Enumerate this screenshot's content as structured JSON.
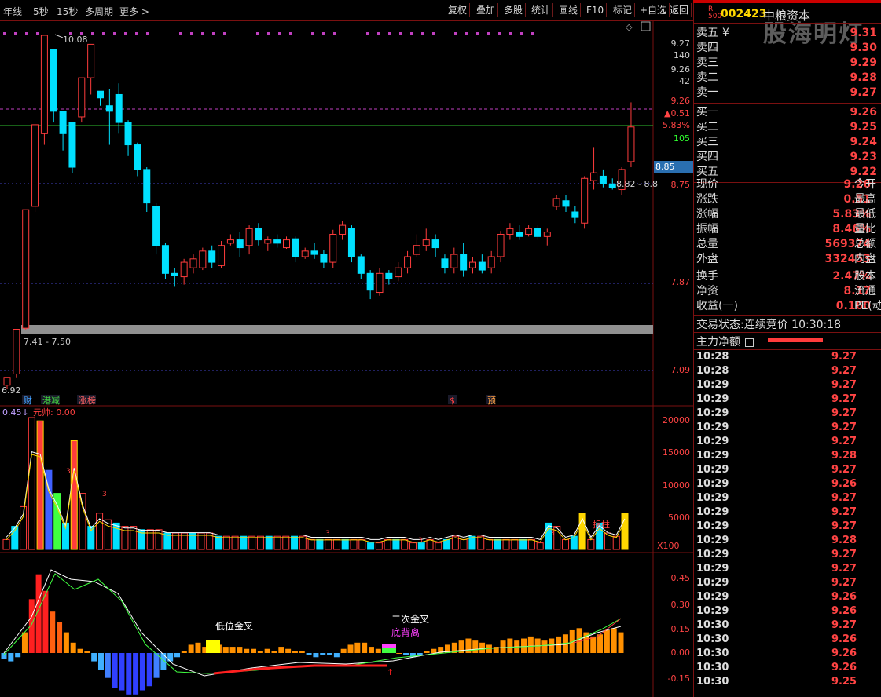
{
  "toolbar": {
    "left_items": [
      "年线",
      "5秒",
      "15秒",
      "多周期",
      "更多 >"
    ],
    "buttons": [
      "复权",
      "叠加",
      "多股",
      "统计",
      "画线",
      "F10",
      "标记",
      "+自选",
      "返回"
    ]
  },
  "watermark": "股海明灯",
  "stock": {
    "badge_top": "R",
    "badge_bottom": "500",
    "code": "002423",
    "name": "中粮资本"
  },
  "order_book": {
    "asks": [
      {
        "label": "卖五",
        "price": "9.31",
        "mark": "¥"
      },
      {
        "label": "卖四",
        "price": "9.30"
      },
      {
        "label": "卖三",
        "price": "9.29"
      },
      {
        "label": "卖二",
        "price": "9.28"
      },
      {
        "label": "卖一",
        "price": "9.27"
      }
    ],
    "bids": [
      {
        "label": "买一",
        "price": "9.26"
      },
      {
        "label": "买二",
        "price": "9.25"
      },
      {
        "label": "买三",
        "price": "9.24"
      },
      {
        "label": "买四",
        "price": "9.23"
      },
      {
        "label": "买五",
        "price": "9.22"
      }
    ]
  },
  "quote": [
    {
      "label": "现价",
      "value": "9.26",
      "label2": "今开"
    },
    {
      "label": "涨跌",
      "value": "0.51",
      "label2": "最高"
    },
    {
      "label": "涨幅",
      "value": "5.83%",
      "label2": "最低"
    },
    {
      "label": "振幅",
      "value": "8.46%",
      "label2": "量比"
    },
    {
      "label": "总量",
      "value": "569374",
      "label2": "总额"
    },
    {
      "label": "外盘",
      "value": "332453",
      "label2": "内盘"
    }
  ],
  "stats": [
    {
      "label": "换手",
      "value": "2.47%",
      "label2": "股本"
    },
    {
      "label": "净资",
      "value": "8.17",
      "label2": "流通"
    },
    {
      "label": "收益(一)",
      "value": "0.160",
      "label2": "PE(动"
    }
  ],
  "trade_status": {
    "label": "交易状态:",
    "state": "连续竞价",
    "time": "10:30:18"
  },
  "main_net": {
    "label": "主力净额"
  },
  "ticks": [
    {
      "time": "10:28",
      "price": "9.27"
    },
    {
      "time": "10:28",
      "price": "9.27"
    },
    {
      "time": "10:29",
      "price": "9.27"
    },
    {
      "time": "10:29",
      "price": "9.27"
    },
    {
      "time": "10:29",
      "price": "9.27"
    },
    {
      "time": "10:29",
      "price": "9.27"
    },
    {
      "time": "10:29",
      "price": "9.27"
    },
    {
      "time": "10:29",
      "price": "9.28"
    },
    {
      "time": "10:29",
      "price": "9.27"
    },
    {
      "time": "10:29",
      "price": "9.26"
    },
    {
      "time": "10:29",
      "price": "9.27"
    },
    {
      "time": "10:29",
      "price": "9.27"
    },
    {
      "time": "10:29",
      "price": "9.27"
    },
    {
      "time": "10:29",
      "price": "9.28"
    },
    {
      "time": "10:29",
      "price": "9.27"
    },
    {
      "time": "10:29",
      "price": "9.27"
    },
    {
      "time": "10:29",
      "price": "9.27"
    },
    {
      "time": "10:29",
      "price": "9.26"
    },
    {
      "time": "10:29",
      "price": "9.26"
    },
    {
      "time": "10:30",
      "price": "9.27"
    },
    {
      "time": "10:30",
      "price": "9.26"
    },
    {
      "time": "10:30",
      "price": "9.26"
    },
    {
      "time": "10:30",
      "price": "9.26"
    },
    {
      "time": "10:30",
      "price": "9.25"
    }
  ],
  "colors": {
    "up": "#ff3c3c",
    "down": "#00e0ff",
    "accent": "#ff4444",
    "frame": "#7a1010"
  },
  "chart_data": [
    {
      "type": "candlestick",
      "axis_labels": [
        "9.27",
        "140",
        "9.26",
        "42",
        "9.26",
        "▲0.51",
        "5.83%",
        "105",
        "8.85",
        "8.75",
        "7.87",
        "7.09"
      ],
      "annotations": {
        "high": "10.08",
        "low": "6.92",
        "range1": "7.41 - 7.50",
        "range2": "8.82 - 8.8"
      },
      "event_tags": [
        "财",
        "港减",
        "涨榜",
        "$",
        "预"
      ],
      "candles": [
        [
          6.95,
          7.02,
          6.92,
          7.0
        ],
        [
          7.05,
          7.45,
          7.02,
          7.44
        ],
        [
          7.46,
          8.52,
          7.44,
          8.5
        ],
        [
          8.55,
          9.28,
          8.5,
          9.25
        ],
        [
          9.2,
          10.08,
          9.1,
          9.9
        ],
        [
          9.95,
          9.4,
          9.3,
          9.45
        ],
        [
          9.4,
          9.2,
          9.05,
          9.22
        ],
        [
          9.3,
          8.9,
          8.85,
          8.98
        ],
        [
          9.35,
          9.7,
          9.3,
          9.68
        ],
        [
          9.7,
          10.0,
          9.55,
          9.8
        ],
        [
          9.58,
          9.52,
          9.45,
          9.55
        ],
        [
          9.45,
          9.4,
          9.1,
          9.6
        ],
        [
          9.55,
          9.3,
          9.2,
          9.65
        ],
        [
          9.3,
          9.1,
          9.0,
          9.32
        ],
        [
          9.1,
          8.88,
          8.82,
          9.12
        ],
        [
          8.88,
          8.58,
          8.5,
          8.9
        ],
        [
          8.55,
          8.2,
          8.12,
          8.58
        ],
        [
          8.2,
          7.95,
          7.9,
          8.22
        ],
        [
          7.95,
          7.93,
          7.83,
          8.0
        ],
        [
          7.92,
          8.05,
          7.85,
          8.08
        ],
        [
          8.0,
          8.08,
          7.95,
          8.12
        ],
        [
          8.0,
          8.15,
          7.98,
          8.18
        ],
        [
          8.15,
          8.05,
          8.0,
          8.2
        ],
        [
          8.02,
          8.2,
          8.0,
          8.24
        ],
        [
          8.22,
          8.25,
          8.2,
          8.3
        ],
        [
          8.25,
          8.18,
          8.1,
          8.32
        ],
        [
          8.2,
          8.35,
          8.12,
          8.38
        ],
        [
          8.35,
          8.25,
          8.2,
          8.4
        ],
        [
          8.22,
          8.25,
          8.15,
          8.28
        ],
        [
          8.25,
          8.22,
          8.18,
          8.3
        ],
        [
          8.18,
          8.25,
          8.17,
          8.28
        ],
        [
          8.26,
          8.1,
          8.05,
          8.28
        ],
        [
          8.1,
          8.15,
          8.08,
          8.18
        ],
        [
          8.15,
          8.12,
          8.08,
          8.22
        ],
        [
          8.12,
          8.05,
          8.0,
          8.16
        ],
        [
          8.05,
          8.3,
          8.0,
          8.34
        ],
        [
          8.3,
          8.38,
          8.25,
          8.42
        ],
        [
          8.35,
          8.1,
          8.05,
          8.38
        ],
        [
          8.1,
          7.95,
          7.9,
          8.12
        ],
        [
          7.95,
          7.8,
          7.72,
          7.98
        ],
        [
          7.78,
          7.95,
          7.75,
          8.0
        ],
        [
          7.95,
          7.9,
          7.85,
          7.98
        ],
        [
          7.92,
          8.0,
          7.88,
          8.05
        ],
        [
          8.0,
          8.1,
          7.95,
          8.15
        ],
        [
          8.12,
          8.2,
          8.1,
          8.3
        ],
        [
          8.2,
          8.25,
          8.15,
          8.35
        ],
        [
          8.25,
          8.18,
          8.1,
          8.3
        ],
        [
          8.08,
          8.0,
          7.95,
          8.12
        ],
        [
          8.0,
          8.12,
          7.95,
          8.18
        ],
        [
          8.12,
          7.98,
          7.92,
          8.22
        ],
        [
          8.0,
          8.05,
          7.95,
          8.1
        ],
        [
          8.05,
          7.98,
          7.95,
          8.12
        ],
        [
          8.0,
          8.1,
          7.95,
          8.15
        ],
        [
          8.1,
          8.3,
          8.05,
          8.33
        ],
        [
          8.3,
          8.35,
          8.25,
          8.4
        ],
        [
          8.32,
          8.28,
          8.25,
          8.38
        ],
        [
          8.3,
          8.35,
          8.28,
          8.38
        ],
        [
          8.35,
          8.28,
          8.25,
          8.38
        ],
        [
          8.28,
          8.32,
          8.2,
          8.35
        ],
        [
          8.55,
          8.62,
          8.52,
          8.65
        ],
        [
          8.6,
          8.55,
          8.5,
          8.65
        ],
        [
          8.5,
          8.45,
          8.4,
          8.55
        ],
        [
          8.4,
          8.8,
          8.35,
          8.82
        ],
        [
          8.78,
          8.85,
          8.7,
          9.08
        ],
        [
          8.82,
          8.75,
          8.72,
          8.88
        ],
        [
          8.75,
          8.72,
          8.7,
          8.8
        ],
        [
          8.7,
          8.88,
          8.65,
          8.9
        ],
        [
          8.95,
          9.26,
          8.9,
          9.48
        ]
      ]
    },
    {
      "type": "bar",
      "axis_labels": [
        "20000",
        "15000",
        "10000",
        "5000",
        "X100"
      ],
      "indicator_labels": [
        "0.45↓",
        "元帅: 0.00"
      ],
      "tags": [
        "3",
        "3",
        "3",
        "3",
        "3",
        "拐柱"
      ],
      "values": [
        1500,
        3500,
        6500,
        20000,
        19500,
        12000,
        8500,
        4000,
        16500,
        8500,
        3500,
        5500,
        4500,
        4000,
        3500,
        3500,
        3000,
        3000,
        3000,
        2500,
        2500,
        2500,
        2500,
        2500,
        2500,
        2000,
        2000,
        2000,
        2000,
        2000,
        2000,
        2000,
        2000,
        2000,
        2000,
        2000,
        1500,
        1500,
        1500,
        1500,
        1500,
        1500,
        1500,
        1000,
        1000,
        1500,
        1500,
        1500,
        1000,
        1000,
        1500,
        1000,
        1500,
        2000,
        1500,
        2000,
        2000,
        1500,
        1500,
        1500,
        1500,
        1500,
        1500,
        1000,
        4000,
        3500,
        1500,
        2000,
        5500,
        1500,
        4000,
        2500,
        2000,
        5500
      ]
    },
    {
      "type": "bar",
      "axis_labels": [
        "0.45",
        "0.30",
        "0.15",
        "0.00",
        "-0.15"
      ],
      "annotations": [
        "低位金叉",
        "二次金叉",
        "底背离"
      ],
      "values": [
        -0.03,
        -0.04,
        -0.02,
        0.1,
        0.26,
        0.38,
        0.3,
        0.2,
        0.15,
        0.1,
        0.05,
        0.02,
        0.01,
        -0.04,
        -0.08,
        -0.12,
        -0.17,
        -0.18,
        -0.2,
        -0.2,
        -0.18,
        -0.16,
        -0.12,
        -0.08,
        -0.04,
        -0.02,
        0.01,
        0.04,
        0.05,
        0.03,
        0.04,
        0.04,
        0.03,
        0.03,
        0.03,
        0.02,
        0.02,
        0.01,
        0.02,
        0.01,
        0.03,
        0.02,
        0.01,
        0.01,
        -0.01,
        -0.02,
        -0.01,
        -0.01,
        -0.02,
        0.02,
        0.04,
        0.05,
        0.05,
        0.03,
        0.02,
        0.01,
        0.01,
        0.0,
        -0.01,
        -0.02,
        -0.01,
        0.01,
        0.02,
        0.03,
        0.04,
        0.05,
        0.06,
        0.07,
        0.06,
        0.05,
        0.04,
        0.03,
        0.06,
        0.07,
        0.06,
        0.07,
        0.08,
        0.07,
        0.06,
        0.07,
        0.08,
        0.09,
        0.11,
        0.12,
        0.1,
        0.08,
        0.09,
        0.11,
        0.12,
        0.1
      ]
    }
  ]
}
